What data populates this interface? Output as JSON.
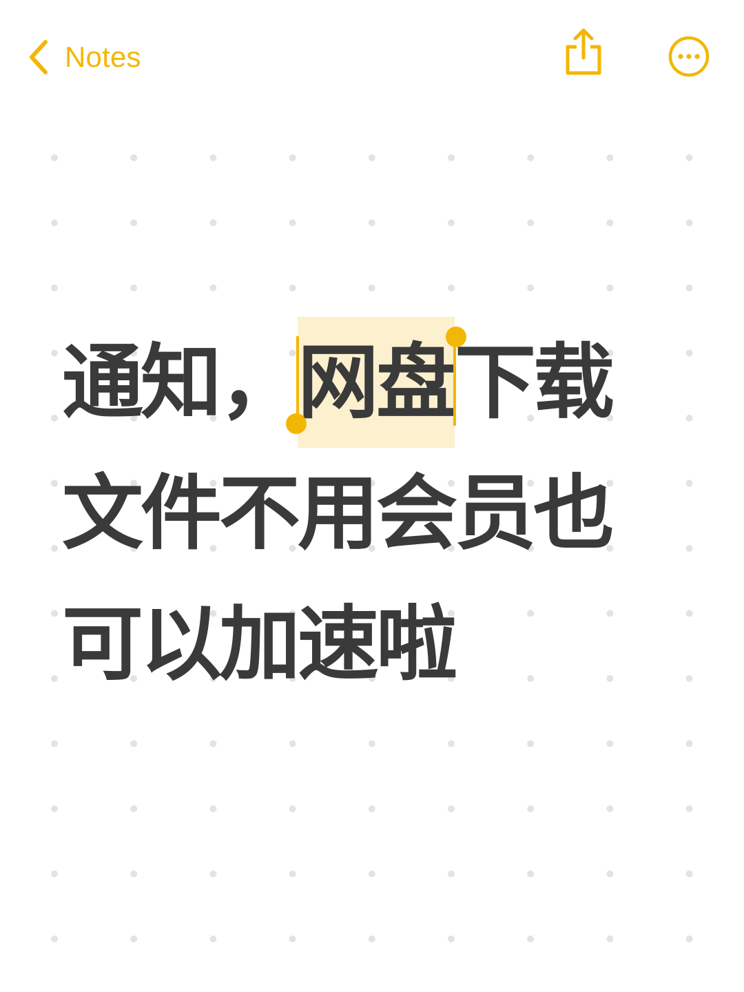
{
  "nav": {
    "back_label": "Notes",
    "accent_color": "#F2B705",
    "share_icon": "share-icon",
    "more_icon": "ellipsis-circle-icon"
  },
  "note": {
    "line1_before": "通知，",
    "line1_selected": "网盘",
    "line1_after": "下载",
    "line2": "文件不用会员也",
    "line3": "可以加速啦",
    "text_color": "#3A3A3A",
    "selection_color": "#FCF0CF"
  },
  "background": {
    "color": "#FFFFFF",
    "dot_color": "#E3E3E3"
  }
}
